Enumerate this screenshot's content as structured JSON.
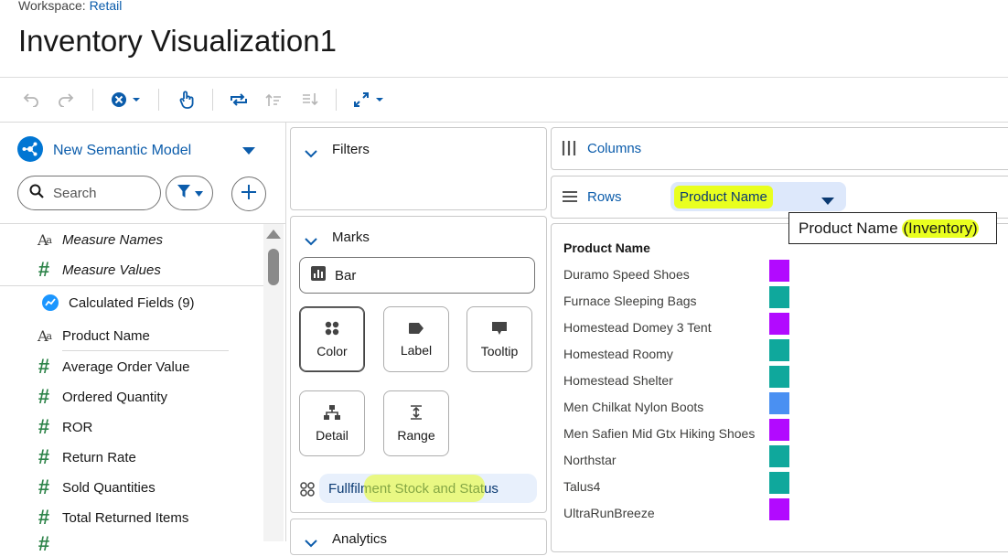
{
  "header": {
    "workspace_label": "Workspace:",
    "workspace_name": "Retail",
    "title": "Inventory Visualization1"
  },
  "toolbar": {
    "icons": [
      "undo-icon",
      "redo-icon",
      "clear-icon",
      "pointer-icon",
      "swap-icon",
      "sort-ascending-icon",
      "sort-descending-icon",
      "fit-icon"
    ]
  },
  "data_panel": {
    "model_name": "New Semantic Model",
    "search_placeholder": "Search",
    "fields": [
      {
        "label": "Measure Names",
        "type": "text",
        "italic": true
      },
      {
        "label": "Measure Values",
        "type": "number",
        "italic": true
      },
      {
        "label": "Calculated Fields (9)",
        "type": "calculated"
      },
      {
        "label": "Product Name",
        "type": "text"
      },
      {
        "label": "Average Order Value",
        "type": "number"
      },
      {
        "label": "Ordered Quantity",
        "type": "number"
      },
      {
        "label": "ROR",
        "type": "number"
      },
      {
        "label": "Return Rate",
        "type": "number"
      },
      {
        "label": "Sold Quantities",
        "type": "number"
      },
      {
        "label": "Total Returned Items",
        "type": "number"
      }
    ]
  },
  "filters": {
    "title": "Filters"
  },
  "marks": {
    "title": "Marks",
    "mark_type": "Bar",
    "properties": [
      {
        "label": "Color",
        "icon": "color-icon",
        "active": true
      },
      {
        "label": "Label",
        "icon": "label-icon"
      },
      {
        "label": "Tooltip",
        "icon": "tooltip-icon"
      },
      {
        "label": "Detail",
        "icon": "detail-icon"
      },
      {
        "label": "Range",
        "icon": "range-icon"
      }
    ],
    "color_field": "Fullfilment Stock and Status"
  },
  "analytics": {
    "title": "Analytics"
  },
  "shelves": {
    "columns_label": "Columns",
    "rows_label": "Rows",
    "rows_field": "Product Name",
    "tooltip_prefix": "Product Name ",
    "tooltip_source": "(Inventory)"
  },
  "viz": {
    "header": "Product Name",
    "rows": [
      {
        "name": "Duramo Speed Shoes",
        "color": "#b20aff"
      },
      {
        "name": "Furnace Sleeping Bags",
        "color": "#0fa89c"
      },
      {
        "name": "Homestead Domey 3 Tent",
        "color": "#b20aff"
      },
      {
        "name": "Homestead Roomy",
        "color": "#0fa89c"
      },
      {
        "name": "Homestead Shelter",
        "color": "#0fa89c"
      },
      {
        "name": "Men Chilkat Nylon Boots",
        "color": "#4a90f2"
      },
      {
        "name": "Men Safien Mid Gtx Hiking Shoes",
        "color": "#b20aff"
      },
      {
        "name": "Northstar",
        "color": "#0fa89c"
      },
      {
        "name": "Talus4",
        "color": "#0fa89c"
      },
      {
        "name": "UltraRunBreeze",
        "color": "#b20aff"
      }
    ]
  }
}
